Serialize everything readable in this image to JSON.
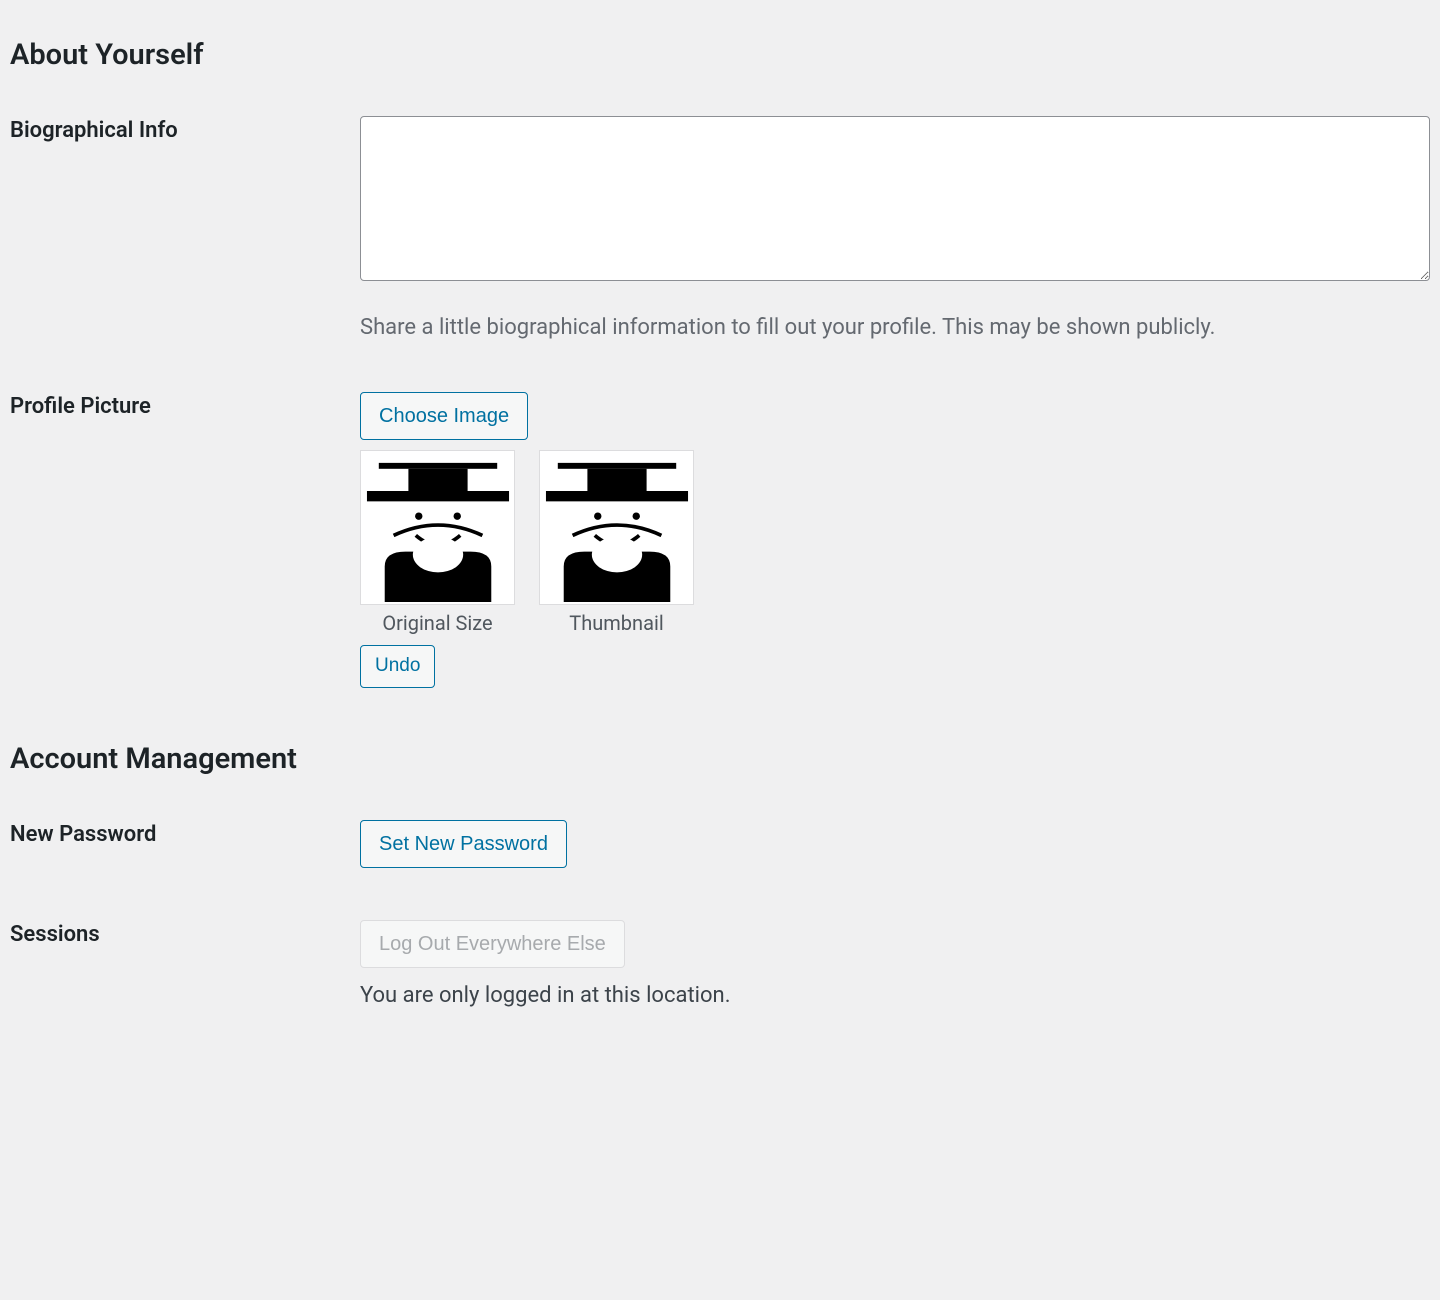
{
  "sections": {
    "about": {
      "title": "About Yourself"
    },
    "account": {
      "title": "Account Management"
    }
  },
  "bio": {
    "label": "Biographical Info",
    "value": "",
    "help": "Share a little biographical information to fill out your profile. This may be shown publicly."
  },
  "profile_picture": {
    "label": "Profile Picture",
    "choose_button": "Choose Image",
    "original_caption": "Original Size",
    "thumbnail_caption": "Thumbnail",
    "undo_button": "Undo"
  },
  "password": {
    "label": "New Password",
    "button": "Set New Password"
  },
  "sessions": {
    "label": "Sessions",
    "button": "Log Out Everywhere Else",
    "help": "You are only logged in at this location."
  }
}
